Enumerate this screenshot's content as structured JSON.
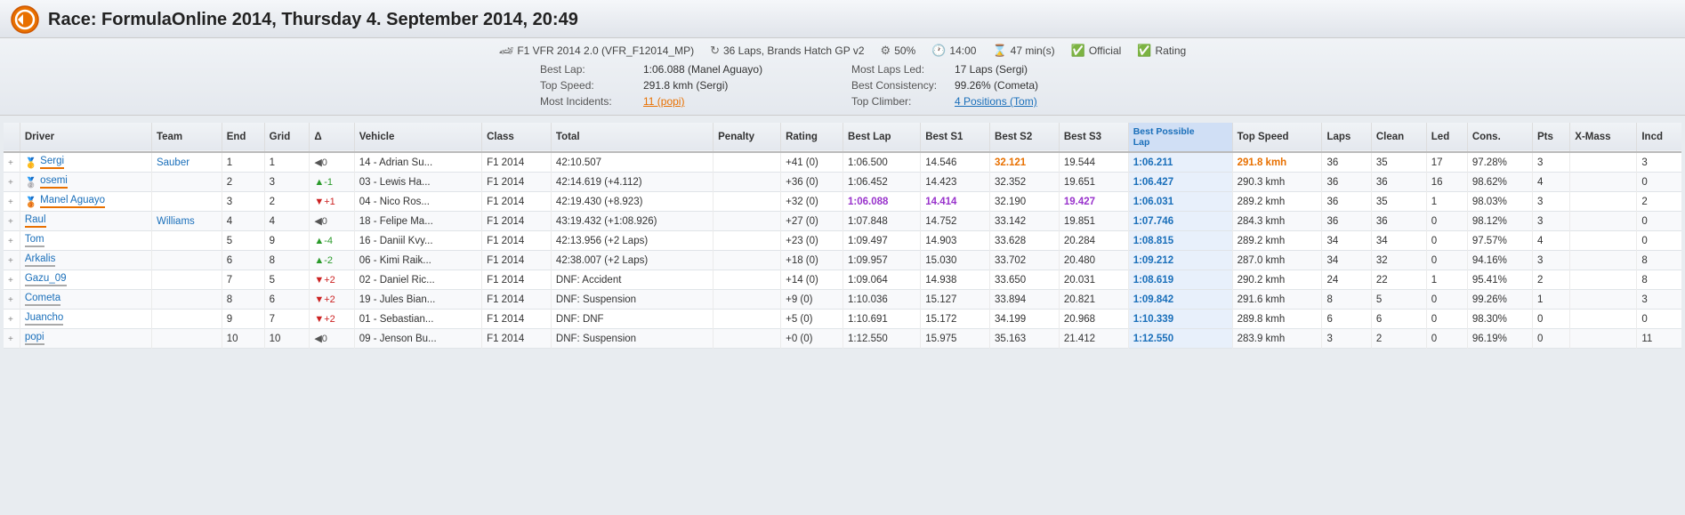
{
  "header": {
    "title": "Race: FormulaOnline 2014, Thursday 4. September 2014, 20:49"
  },
  "meta": {
    "car": "F1 VFR 2014 2.0 (VFR_F12014_MP)",
    "laps_track": "36 Laps, Brands Hatch GP v2",
    "strength": "50%",
    "time": "14:00",
    "duration": "47 min(s)",
    "official": "Official",
    "rating": "Rating",
    "best_lap_label": "Best Lap:",
    "best_lap_value": "1:06.088 (Manel Aguayo)",
    "top_speed_label": "Top Speed:",
    "top_speed_value": "291.8 kmh (Sergi)",
    "most_incidents_label": "Most Incidents:",
    "most_incidents_value": "11 (popi)",
    "most_laps_led_label": "Most Laps Led:",
    "most_laps_led_value": "17 Laps (Sergi)",
    "best_consistency_label": "Best Consistency:",
    "best_consistency_value": "99.26% (Cometa)",
    "top_climber_label": "Top Climber:",
    "top_climber_value": "4 Positions (Tom)"
  },
  "table": {
    "columns": [
      "",
      "Driver",
      "Team",
      "End",
      "Grid",
      "Δ",
      "Vehicle",
      "Class",
      "Total",
      "Penalty",
      "Rating",
      "Best Lap",
      "Best S1",
      "Best S2",
      "Best S3",
      "Best Possible Lap",
      "Top Speed",
      "Laps",
      "Clean",
      "Led",
      "Cons.",
      "Pts",
      "X-Mass",
      "Incd"
    ],
    "rows": [
      {
        "medal": "🥇",
        "driver": "Sergi",
        "driver_style": "orange",
        "team": "Sauber",
        "end": "1",
        "grid": "1",
        "delta": "←0",
        "delta_type": "zero",
        "vehicle": "14 - Adrian Su...",
        "class": "F1 2014",
        "total": "42:10.507",
        "penalty": "",
        "rating": "+41 (0)",
        "best_lap": "1:06.500",
        "best_s1": "14.546",
        "best_s2": "32.121",
        "best_s3": "19.544",
        "best_possible": "1:06.211",
        "top_speed": "291.8 kmh",
        "laps": "36",
        "clean": "35",
        "led": "17",
        "cons": "97.28%",
        "pts": "3",
        "xmass": "",
        "incd": "3",
        "s2_highlight": true,
        "speed_highlight": true
      },
      {
        "medal": "🥈",
        "driver": "osemi",
        "driver_style": "orange",
        "team": "",
        "end": "2",
        "grid": "3",
        "delta": "↑-1",
        "delta_type": "up",
        "vehicle": "03 - Lewis Ha...",
        "class": "F1 2014",
        "total": "42:14.619 (+4.112)",
        "penalty": "",
        "rating": "+36 (0)",
        "best_lap": "1:06.452",
        "best_s1": "14.423",
        "best_s2": "32.352",
        "best_s3": "19.651",
        "best_possible": "1:06.427",
        "top_speed": "290.3 kmh",
        "laps": "36",
        "clean": "36",
        "led": "16",
        "cons": "98.62%",
        "pts": "4",
        "xmass": "",
        "incd": "0"
      },
      {
        "medal": "🥉",
        "driver": "Manel Aguayo",
        "driver_style": "orange",
        "team": "",
        "end": "3",
        "grid": "2",
        "delta": "↓+1",
        "delta_type": "down",
        "vehicle": "04 - Nico Ros...",
        "class": "F1 2014",
        "total": "42:19.430 (+8.923)",
        "penalty": "",
        "rating": "+32 (0)",
        "best_lap": "1:06.088",
        "best_s1": "14.414",
        "best_s2": "32.190",
        "best_s3": "19.427",
        "best_possible": "1:06.031",
        "top_speed": "289.2 kmh",
        "laps": "36",
        "clean": "35",
        "led": "1",
        "cons": "98.03%",
        "pts": "3",
        "xmass": "",
        "incd": "2",
        "lap_highlight": true,
        "s1_highlight": true,
        "s3_highlight": true
      },
      {
        "medal": "",
        "driver": "Raul",
        "driver_style": "orange",
        "team": "Williams",
        "end": "4",
        "grid": "4",
        "delta": "←0",
        "delta_type": "zero",
        "vehicle": "18 - Felipe Ma...",
        "class": "F1 2014",
        "total": "43:19.432 (+1:08.926)",
        "penalty": "",
        "rating": "+27 (0)",
        "best_lap": "1:07.848",
        "best_s1": "14.752",
        "best_s2": "33.142",
        "best_s3": "19.851",
        "best_possible": "1:07.746",
        "top_speed": "284.3 kmh",
        "laps": "36",
        "clean": "36",
        "led": "0",
        "cons": "98.12%",
        "pts": "3",
        "xmass": "",
        "incd": "0"
      },
      {
        "medal": "",
        "driver": "Tom",
        "driver_style": "gray",
        "team": "",
        "end": "5",
        "grid": "9",
        "delta": "↑-4",
        "delta_type": "up",
        "vehicle": "16 - Daniil Kvy...",
        "class": "F1 2014",
        "total": "42:13.956 (+2 Laps)",
        "penalty": "",
        "rating": "+23 (0)",
        "best_lap": "1:09.497",
        "best_s1": "14.903",
        "best_s2": "33.628",
        "best_s3": "20.284",
        "best_possible": "1:08.815",
        "top_speed": "289.2 kmh",
        "laps": "34",
        "clean": "34",
        "led": "0",
        "cons": "97.57%",
        "pts": "4",
        "xmass": "",
        "incd": "0"
      },
      {
        "medal": "",
        "driver": "Arkalis",
        "driver_style": "gray",
        "team": "",
        "end": "6",
        "grid": "8",
        "delta": "↑-2",
        "delta_type": "up",
        "vehicle": "06 - Kimi Raik...",
        "class": "F1 2014",
        "total": "42:38.007 (+2 Laps)",
        "penalty": "",
        "rating": "+18 (0)",
        "best_lap": "1:09.957",
        "best_s1": "15.030",
        "best_s2": "33.702",
        "best_s3": "20.480",
        "best_possible": "1:09.212",
        "top_speed": "287.0 kmh",
        "laps": "34",
        "clean": "32",
        "led": "0",
        "cons": "94.16%",
        "pts": "3",
        "xmass": "",
        "incd": "8"
      },
      {
        "medal": "",
        "driver": "Gazu_09",
        "driver_style": "gray",
        "team": "",
        "end": "7",
        "grid": "5",
        "delta": "↓+2",
        "delta_type": "down",
        "vehicle": "02 - Daniel Ric...",
        "class": "F1 2014",
        "total": "DNF: Accident",
        "penalty": "",
        "rating": "+14 (0)",
        "best_lap": "1:09.064",
        "best_s1": "14.938",
        "best_s2": "33.650",
        "best_s3": "20.031",
        "best_possible": "1:08.619",
        "top_speed": "290.2 kmh",
        "laps": "24",
        "clean": "22",
        "led": "1",
        "cons": "95.41%",
        "pts": "2",
        "xmass": "",
        "incd": "8"
      },
      {
        "medal": "",
        "driver": "Cometa",
        "driver_style": "gray",
        "team": "",
        "end": "8",
        "grid": "6",
        "delta": "↓+2",
        "delta_type": "down",
        "vehicle": "19 - Jules Bian...",
        "class": "F1 2014",
        "total": "DNF: Suspension",
        "penalty": "",
        "rating": "+9 (0)",
        "best_lap": "1:10.036",
        "best_s1": "15.127",
        "best_s2": "33.894",
        "best_s3": "20.821",
        "best_possible": "1:09.842",
        "top_speed": "291.6 kmh",
        "laps": "8",
        "clean": "5",
        "led": "0",
        "cons": "99.26%",
        "pts": "1",
        "xmass": "",
        "incd": "3"
      },
      {
        "medal": "",
        "driver": "Juancho",
        "driver_style": "gray",
        "team": "",
        "end": "9",
        "grid": "7",
        "delta": "↓+2",
        "delta_type": "down",
        "vehicle": "01 - Sebastian...",
        "class": "F1 2014",
        "total": "DNF: DNF",
        "penalty": "",
        "rating": "+5 (0)",
        "best_lap": "1:10.691",
        "best_s1": "15.172",
        "best_s2": "34.199",
        "best_s3": "20.968",
        "best_possible": "1:10.339",
        "top_speed": "289.8 kmh",
        "laps": "6",
        "clean": "6",
        "led": "0",
        "cons": "98.30%",
        "pts": "0",
        "xmass": "",
        "incd": "0"
      },
      {
        "medal": "",
        "driver": "popi",
        "driver_style": "gray",
        "team": "",
        "end": "10",
        "grid": "10",
        "delta": "←0",
        "delta_type": "zero",
        "vehicle": "09 - Jenson Bu...",
        "class": "F1 2014",
        "total": "DNF: Suspension",
        "penalty": "",
        "rating": "+0 (0)",
        "best_lap": "1:12.550",
        "best_s1": "15.975",
        "best_s2": "35.163",
        "best_s3": "21.412",
        "best_possible": "1:12.550",
        "top_speed": "283.9 kmh",
        "laps": "3",
        "clean": "2",
        "led": "0",
        "cons": "96.19%",
        "pts": "0",
        "xmass": "",
        "incd": "11"
      }
    ]
  }
}
